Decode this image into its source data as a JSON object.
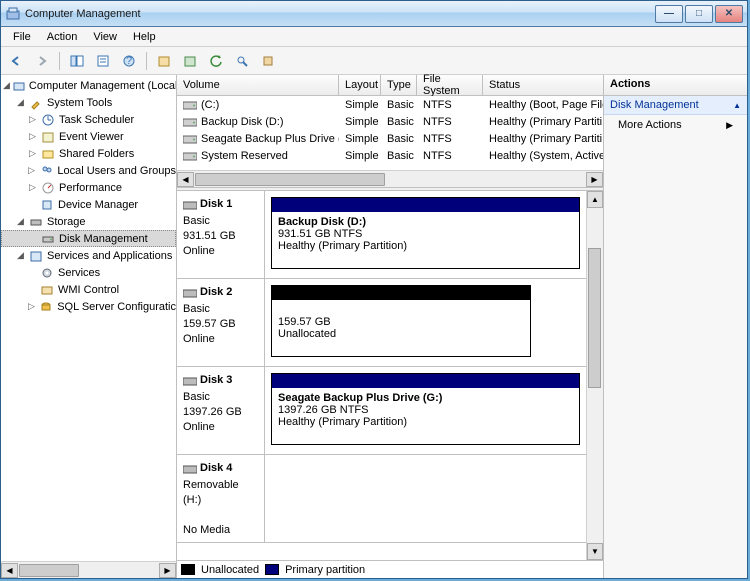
{
  "window": {
    "title": "Computer Management"
  },
  "menus": [
    "File",
    "Action",
    "View",
    "Help"
  ],
  "tree": {
    "root": "Computer Management (Local",
    "system_tools": "System Tools",
    "task_scheduler": "Task Scheduler",
    "event_viewer": "Event Viewer",
    "shared_folders": "Shared Folders",
    "local_users": "Local Users and Groups",
    "performance": "Performance",
    "device_manager": "Device Manager",
    "storage": "Storage",
    "disk_management": "Disk Management",
    "services_apps": "Services and Applications",
    "services": "Services",
    "wmi": "WMI Control",
    "sql": "SQL Server Configuratic"
  },
  "vol_headers": {
    "volume": "Volume",
    "layout": "Layout",
    "type": "Type",
    "fs": "File System",
    "status": "Status"
  },
  "volumes": [
    {
      "name": "(C:)",
      "layout": "Simple",
      "type": "Basic",
      "fs": "NTFS",
      "status": "Healthy (Boot, Page File"
    },
    {
      "name": "Backup Disk (D:)",
      "layout": "Simple",
      "type": "Basic",
      "fs": "NTFS",
      "status": "Healthy (Primary Partiti"
    },
    {
      "name": "Seagate Backup Plus Drive (G:)",
      "layout": "Simple",
      "type": "Basic",
      "fs": "NTFS",
      "status": "Healthy (Primary Partiti"
    },
    {
      "name": "System Reserved",
      "layout": "Simple",
      "type": "Basic",
      "fs": "NTFS",
      "status": "Healthy (System, Active"
    }
  ],
  "disks": [
    {
      "title": "Disk 1",
      "sub": "Basic",
      "size": "931.51 GB",
      "state": "Online",
      "part_type": "primary",
      "part_name": "Backup Disk  (D:)",
      "part_line2": "931.51 GB NTFS",
      "part_line3": "Healthy (Primary Partition)"
    },
    {
      "title": "Disk 2",
      "sub": "Basic",
      "size": "159.57 GB",
      "state": "Online",
      "part_type": "unalloc",
      "part_name": "",
      "part_line2": "159.57 GB",
      "part_line3": "Unallocated"
    },
    {
      "title": "Disk 3",
      "sub": "Basic",
      "size": "1397.26 GB",
      "state": "Online",
      "part_type": "primary",
      "part_name": "Seagate Backup Plus Drive  (G:)",
      "part_line2": "1397.26 GB NTFS",
      "part_line3": "Healthy (Primary Partition)"
    },
    {
      "title": "Disk 4",
      "sub": "Removable (H:)",
      "size": "",
      "state": "No Media",
      "part_type": "none",
      "part_name": "",
      "part_line2": "",
      "part_line3": ""
    }
  ],
  "legend": {
    "unalloc": "Unallocated",
    "primary": "Primary partition"
  },
  "actions": {
    "header": "Actions",
    "group": "Disk Management",
    "more": "More Actions"
  }
}
